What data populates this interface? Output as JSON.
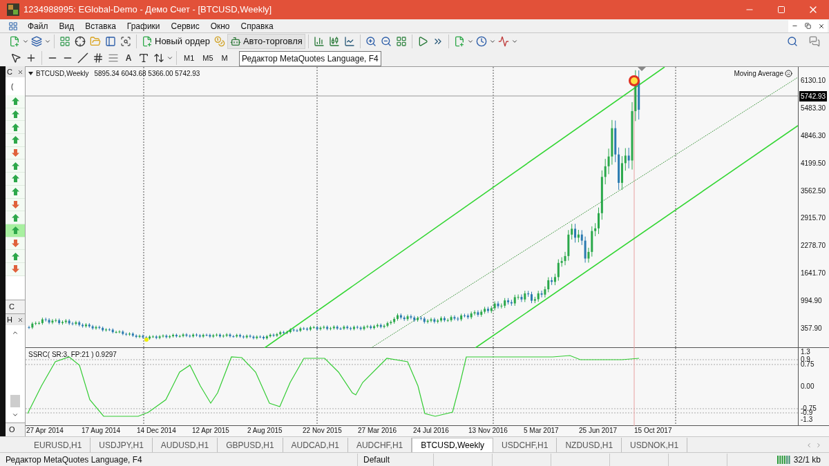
{
  "window": {
    "title": "1234988995: EGlobal-Demo - Демо Счет - [BTCUSD,Weekly]"
  },
  "menu": [
    "Файл",
    "Вид",
    "Вставка",
    "Графики",
    "Сервис",
    "Окно",
    "Справка"
  ],
  "toolbar": {
    "new_order": "Новый ордер",
    "auto_trading": "Авто-торговля"
  },
  "drawing_toolbar": {
    "text_tool": "A",
    "timeframes": [
      "M1",
      "M5",
      "M"
    ]
  },
  "tooltip": "Редактор MetaQuotes Language, F4",
  "market_watch": {
    "title": "C",
    "first_row": "(",
    "tab": "C",
    "rows": [
      {
        "kind": "up",
        "selected": false
      },
      {
        "kind": "up",
        "selected": false
      },
      {
        "kind": "up",
        "selected": false
      },
      {
        "kind": "up",
        "selected": false
      },
      {
        "kind": "down",
        "selected": false
      },
      {
        "kind": "up",
        "selected": false
      },
      {
        "kind": "up",
        "selected": false
      },
      {
        "kind": "up",
        "selected": false
      },
      {
        "kind": "down",
        "selected": false
      },
      {
        "kind": "up",
        "selected": false
      },
      {
        "kind": "up",
        "selected": true
      },
      {
        "kind": "down",
        "selected": false
      },
      {
        "kind": "up",
        "selected": false
      },
      {
        "kind": "down",
        "selected": false
      }
    ]
  },
  "navigator": {
    "title": "H",
    "tab": "O"
  },
  "chart": {
    "symbol": "BTCUSD,Weekly",
    "ohlc": "5895.34 6043.68 5366.00 5742.93",
    "indicator_name": "Moving Average",
    "price_labels": [
      "6130.10",
      "5483.30",
      "4846.30",
      "4199.50",
      "3562.50",
      "2915.70",
      "2278.70",
      "1641.70",
      "994.90",
      "357.90"
    ],
    "current_price": "5742.93",
    "oscillator": {
      "label": "SSRC( SR:3, FP:21 ) 0.9297",
      "scale": [
        "1.3",
        "0.9",
        "0.75",
        "0.00",
        "-0.75",
        "-0.9",
        "-1.3"
      ]
    },
    "dates": [
      "27 Apr 2014",
      "17 Aug 2014",
      "14 Dec 2014",
      "12 Apr 2015",
      "2 Aug 2015",
      "22 Nov 2015",
      "27 Mar 2016",
      "24 Jul 2016",
      "13 Nov 2016",
      "5 Mar 2017",
      "25 Jun 2017",
      "15 Oct 2017"
    ]
  },
  "tabs": [
    {
      "label": "EURUSD,H1",
      "selected": false
    },
    {
      "label": "USDJPY,H1",
      "selected": false
    },
    {
      "label": "AUDUSD,H1",
      "selected": false
    },
    {
      "label": "GBPUSD,H1",
      "selected": false
    },
    {
      "label": "AUDCAD,H1",
      "selected": false
    },
    {
      "label": "AUDCHF,H1",
      "selected": false
    },
    {
      "label": "BTCUSD,Weekly",
      "selected": true
    },
    {
      "label": "USDCHF,H1",
      "selected": false
    },
    {
      "label": "NZDUSD,H1",
      "selected": false
    },
    {
      "label": "USDNOK,H1",
      "selected": false
    }
  ],
  "status_bar": {
    "hint": "Редактор MetaQuotes Language, F4",
    "profile": "Default",
    "traffic": "32/1 kb"
  }
}
